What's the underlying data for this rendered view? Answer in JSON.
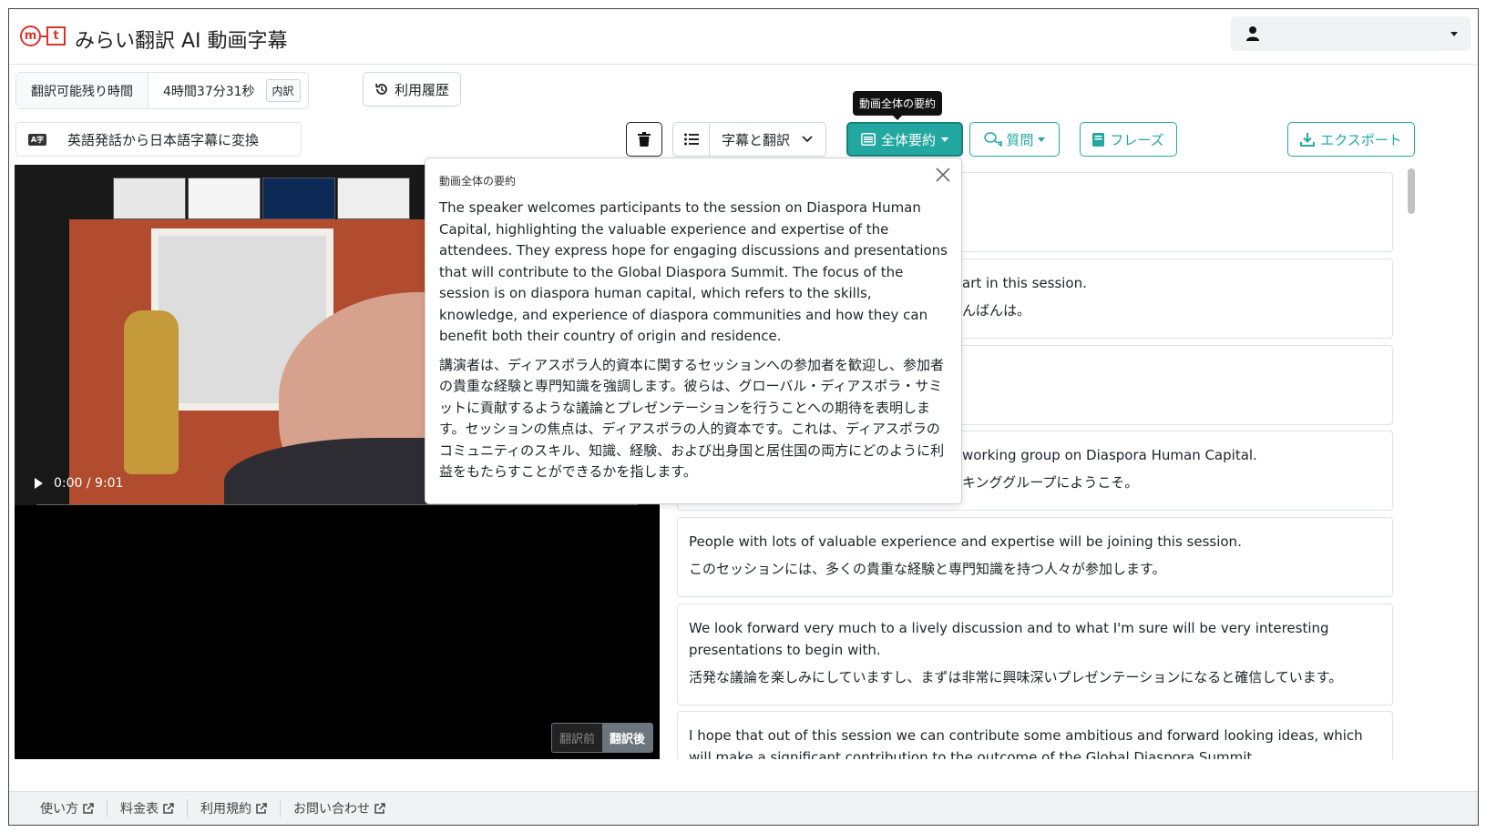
{
  "header": {
    "logo_m": "m",
    "logo_t": "t",
    "title": "みらい翻訳 AI 動画字幕"
  },
  "usage": {
    "label": "翻訳可能残り時間",
    "remaining": "4時間37分31秒",
    "badge": "内訳",
    "history_label": "利用履歴"
  },
  "mode": {
    "icon_text": "A字",
    "label": "英語発話から日本語字幕に変換"
  },
  "toolbar": {
    "view_label": "字幕と翻訳",
    "summary_label": "全体要約",
    "summary_tooltip": "動画全体の要約",
    "question_label": "質問",
    "phrase_label": "フレーズ",
    "export_label": "エクスポート"
  },
  "video": {
    "time": "0:00 / 9:01",
    "progress": 0,
    "toggle_before": "翻訳前",
    "toggle_after": "翻訳後"
  },
  "popover": {
    "title": "動画全体の要約",
    "summary_en": "The speaker welcomes participants to the session on Diaspora Human Capital, highlighting the valuable experience and expertise of the attendees. They express hope for engaging discussions and presentations that will contribute to the Global Diaspora Summit. The focus of the session is on diaspora human capital, which refers to the skills, knowledge, and experience of diaspora communities and how they can benefit both their country of origin and residence.",
    "summary_ja": "講演者は、ディアスポラ人的資本に関するセッションへの参加者を歓迎し、参加者の貴重な経験と専門知識を強調します。彼らは、グローバル・ディアスポラ・サミットに貢献するような議論とプレゼンテーションを行うことへの期待を表明します。セッションの焦点は、ディアスポラの人的資本です。これは、ディアスポラのコミュニティのスキル、知識、経験、および出身国と居住国の両方にどのように利益をもたらすことができるかを指します。"
  },
  "subtitles": [
    {
      "en": "",
      "ja": ""
    },
    {
      "en": "art in this session.",
      "ja": "んばんは。"
    },
    {
      "en": "",
      "ja": ""
    },
    {
      "en": "working group on Diaspora Human Capital.",
      "ja": "キンググループにようこそ。"
    },
    {
      "en": "People with lots of valuable experience and expertise will be joining this session.",
      "ja": "このセッションには、多くの貴重な経験と専門知識を持つ人々が参加します。"
    },
    {
      "en": "We look forward very much to a lively discussion and to what I'm sure will be very interesting presentations to begin with.",
      "ja": "活発な議論を楽しみにしていますし、まずは非常に興味深いプレゼンテーションになると確信しています。"
    },
    {
      "en": "I hope that out of this session we can contribute some ambitious and forward looking ideas, which will make a significant contribution to the outcome of the Global Diaspora Summit.",
      "ja": ""
    }
  ],
  "footer": {
    "links": [
      "使い方",
      "料金表",
      "利用規約",
      "お問い合わせ"
    ]
  },
  "colors": {
    "accent": "#23a8a1",
    "logo": "#d9342b"
  }
}
